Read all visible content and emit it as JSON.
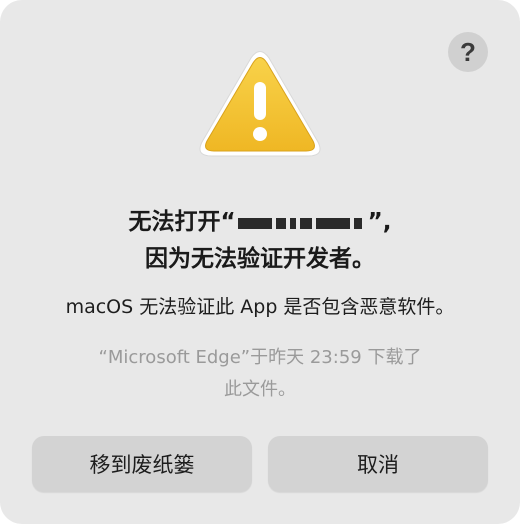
{
  "dialog": {
    "help_label": "?",
    "icon": "warning-triangle-icon",
    "icon_color": "#F5C12E",
    "title_prefix": "无法打开“",
    "title_suffix": "”,",
    "title_line2": "因为无法验证开发者。",
    "message": "macOS 无法验证此 App 是否包含恶意软件。",
    "note_line1": "“Microsoft Edge”于昨天 23:59 下载了",
    "note_line2": "此文件。",
    "buttons": {
      "move_to_trash": "移到废纸篓",
      "cancel": "取消"
    }
  }
}
